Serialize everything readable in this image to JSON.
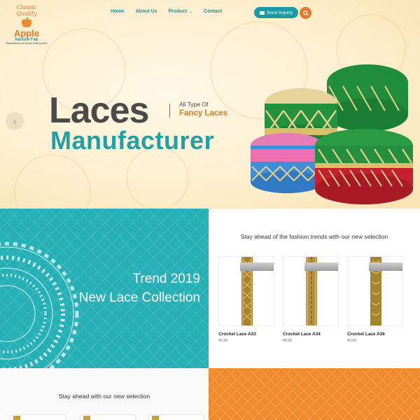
{
  "brand": {
    "script": "Classic Quality",
    "name": "Apple",
    "sub": "Narrow Fab",
    "tagline": "Manufacturers of all type of fancy laces"
  },
  "nav": {
    "items": [
      "Home",
      "About Us",
      "Product",
      "Contact"
    ]
  },
  "header": {
    "inquiry_label": "Send Inquiry"
  },
  "hero": {
    "title_1": "Laces",
    "title_2": "Manufacturer",
    "side_small": "All Type Of",
    "side_accent": "Fancy Laces"
  },
  "trend": {
    "line1": "Trend 2019",
    "line2": "New Lace Collection"
  },
  "products": {
    "heading": "Stay ahead of the fashion trends with our new selection",
    "items": [
      {
        "name": "Crochet Lace A33",
        "price": "₹0.00"
      },
      {
        "name": "Crochet Lace A34",
        "price": "₹0.00"
      },
      {
        "name": "Crochet Lace A36",
        "price": "₹0.00"
      }
    ]
  },
  "section3": {
    "heading": "Stay ahead with our new selection"
  },
  "colors": {
    "teal": "#21a0a7",
    "orange": "#e9782a",
    "dark_text": "#4a4a4a"
  }
}
